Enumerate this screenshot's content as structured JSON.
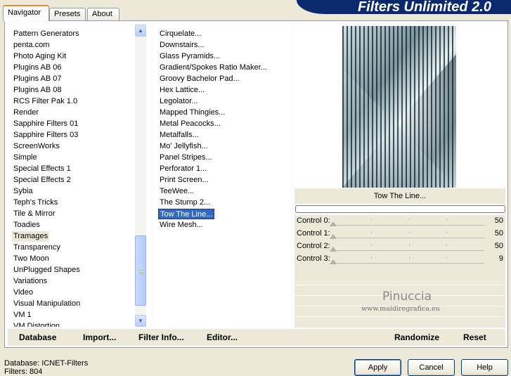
{
  "app": {
    "title": "Filters Unlimited 2.0"
  },
  "tabs": [
    {
      "label": "Navigator"
    },
    {
      "label": "Presets"
    },
    {
      "label": "About"
    }
  ],
  "categories": {
    "items": [
      {
        "label": "Pattern Generators"
      },
      {
        "label": "penta.com"
      },
      {
        "label": "Photo Aging Kit"
      },
      {
        "label": "Plugins AB 06"
      },
      {
        "label": "Plugins AB 07"
      },
      {
        "label": "Plugins AB 08"
      },
      {
        "label": "RCS Filter Pak 1.0"
      },
      {
        "label": "Render"
      },
      {
        "label": "Sapphire Filters 01"
      },
      {
        "label": "Sapphire Filters 03"
      },
      {
        "label": "ScreenWorks"
      },
      {
        "label": "Simple"
      },
      {
        "label": "Special Effects 1"
      },
      {
        "label": "Special Effects 2"
      },
      {
        "label": "Sybia"
      },
      {
        "label": "Teph's Tricks"
      },
      {
        "label": "Tile & Mirror"
      },
      {
        "label": "Toadies"
      },
      {
        "label": "Tramages"
      },
      {
        "label": "Transparency"
      },
      {
        "label": "Two Moon"
      },
      {
        "label": "UnPlugged Shapes"
      },
      {
        "label": "Variations"
      },
      {
        "label": "Video"
      },
      {
        "label": "Visual Manipulation"
      },
      {
        "label": "VM 1"
      },
      {
        "label": "VM Distortion"
      }
    ],
    "selected": "Tramages"
  },
  "filters": {
    "items": [
      {
        "label": "Cirquelate..."
      },
      {
        "label": "Downstairs..."
      },
      {
        "label": "Glass Pyramids..."
      },
      {
        "label": "Gradient/Spokes Ratio Maker..."
      },
      {
        "label": "Groovy Bachelor Pad..."
      },
      {
        "label": "Hex Lattice..."
      },
      {
        "label": "Legolator..."
      },
      {
        "label": "Mapped Thingies..."
      },
      {
        "label": "Metal Peacocks..."
      },
      {
        "label": "Metalfalls..."
      },
      {
        "label": "Mo' Jellyfish..."
      },
      {
        "label": "Panel Stripes..."
      },
      {
        "label": "Perforator 1..."
      },
      {
        "label": "Print Screen..."
      },
      {
        "label": "TeeWee..."
      },
      {
        "label": "The Stump 2..."
      },
      {
        "label": "Tow The Line..."
      },
      {
        "label": "Wire Mesh..."
      }
    ],
    "selected": "Tow The Line..."
  },
  "preview": {
    "filter_name": "Tow The Line..."
  },
  "progress": 0,
  "controls": [
    {
      "label": "Control 0:",
      "value": "50"
    },
    {
      "label": "Control 1:",
      "value": "50"
    },
    {
      "label": "Control 2:",
      "value": "50"
    },
    {
      "label": "Control 3:",
      "value": "9"
    }
  ],
  "watermark": {
    "line1": "Pinuccia",
    "line2": "www.maidiregrafica.eu"
  },
  "bottom_links": {
    "database": "Database",
    "import": "Import...",
    "filter_info": "Filter Info...",
    "editor": "Editor...",
    "randomize": "Randomize",
    "reset": "Reset"
  },
  "status": {
    "database": "Database:   ICNET-Filters",
    "filters": "Filters:      804"
  },
  "buttons": {
    "apply": "Apply",
    "cancel": "Cancel",
    "help": "Help"
  },
  "colors": {
    "banner": "#0b2a6e",
    "selection": "#316ac5"
  }
}
